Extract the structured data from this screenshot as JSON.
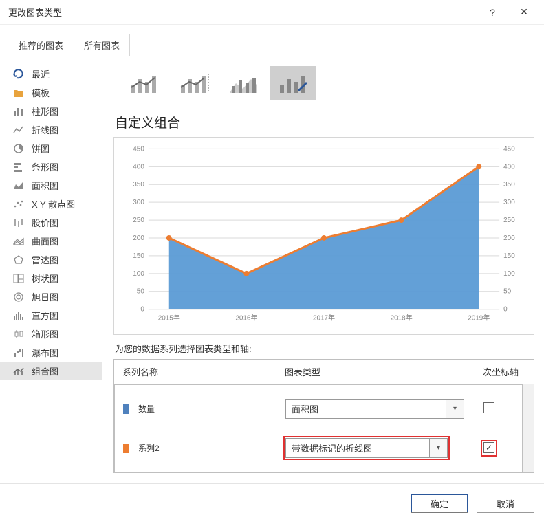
{
  "window": {
    "title": "更改图表类型",
    "help_glyph": "?",
    "close_glyph": "✕"
  },
  "tabs": {
    "recommended": "推荐的图表",
    "all": "所有图表"
  },
  "sidebar": {
    "items": [
      {
        "id": "recent",
        "label": "最近"
      },
      {
        "id": "template",
        "label": "模板"
      },
      {
        "id": "column",
        "label": "柱形图"
      },
      {
        "id": "line",
        "label": "折线图"
      },
      {
        "id": "pie",
        "label": "饼图"
      },
      {
        "id": "bar",
        "label": "条形图"
      },
      {
        "id": "area",
        "label": "面积图"
      },
      {
        "id": "scatter",
        "label": "X Y 散点图"
      },
      {
        "id": "stock",
        "label": "股价图"
      },
      {
        "id": "surface",
        "label": "曲面图"
      },
      {
        "id": "radar",
        "label": "雷达图"
      },
      {
        "id": "treemap",
        "label": "树状图"
      },
      {
        "id": "sunburst",
        "label": "旭日图"
      },
      {
        "id": "histogram",
        "label": "直方图"
      },
      {
        "id": "boxplot",
        "label": "箱形图"
      },
      {
        "id": "waterfall",
        "label": "瀑布图"
      },
      {
        "id": "combo",
        "label": "组合图"
      }
    ]
  },
  "section": {
    "title": "自定义组合",
    "series_caption": "为您的数据系列选择图表类型和轴:"
  },
  "grid": {
    "col_name": "系列名称",
    "col_type": "图表类型",
    "col_secaxis": "次坐标轴",
    "series": [
      {
        "name": "数量",
        "color": "blue",
        "type": "面积图",
        "sec_axis": false
      },
      {
        "name": "系列2",
        "color": "orange",
        "type": "带数据标记的折线图",
        "sec_axis": true
      }
    ]
  },
  "chart_data": {
    "type": "area",
    "categories": [
      "2015年",
      "2016年",
      "2017年",
      "2018年",
      "2019年"
    ],
    "series": [
      {
        "name": "数量",
        "kind": "area",
        "values": [
          200,
          100,
          200,
          250,
          400
        ]
      },
      {
        "name": "系列2",
        "kind": "line",
        "values": [
          200,
          100,
          200,
          250,
          400
        ]
      }
    ],
    "yticks": [
      0,
      50,
      100,
      150,
      200,
      250,
      300,
      350,
      400,
      450
    ],
    "ylim": [
      0,
      450
    ],
    "secondary_axis": {
      "ticks": [
        0,
        50,
        100,
        150,
        200,
        250,
        300,
        350,
        400,
        450
      ],
      "lim": [
        0,
        450
      ]
    },
    "xlabel": "",
    "ylabel": "",
    "title": ""
  },
  "buttons": {
    "ok": "确定",
    "cancel": "取消"
  }
}
